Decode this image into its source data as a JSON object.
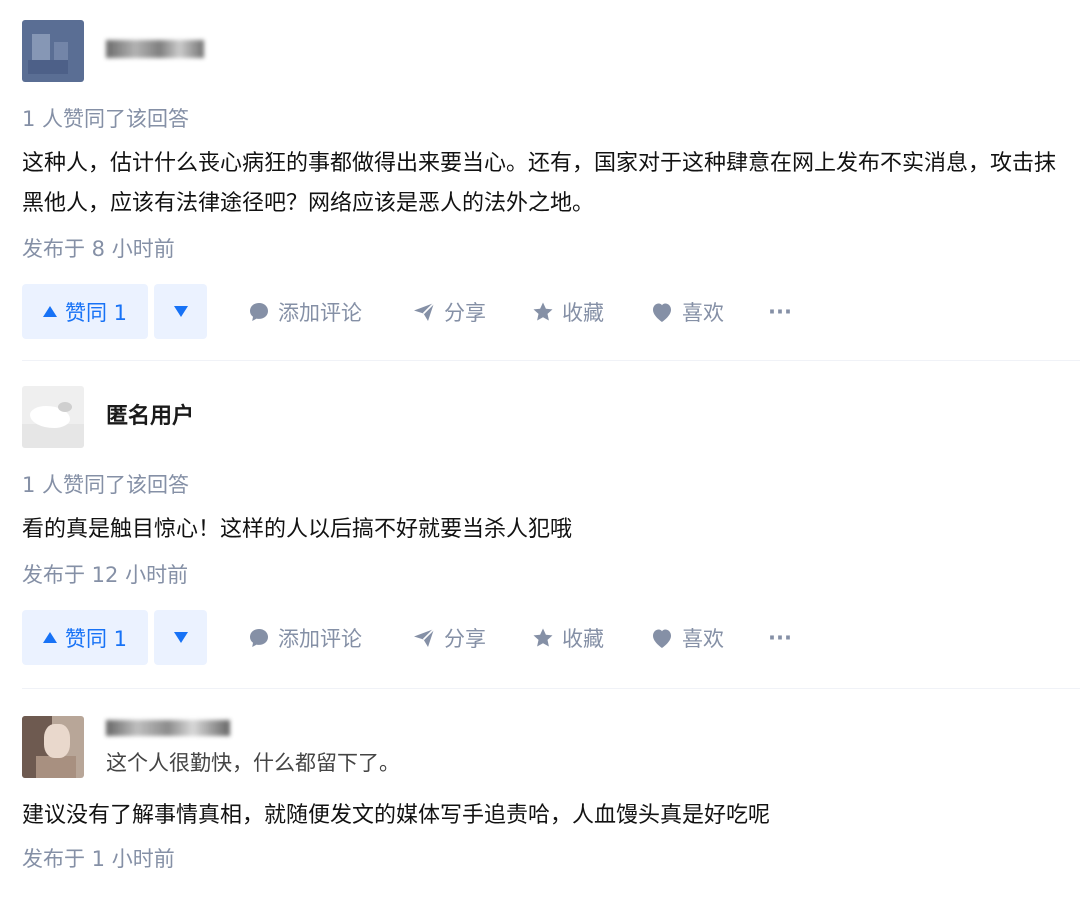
{
  "answers": [
    {
      "author_name": "",
      "bio": "",
      "upvote_note": "1 人赞同了该回答",
      "content": "这种人，估计什么丧心病狂的事都做得出来要当心。还有，国家对于这种肆意在网上发布不实消息，攻击抹黑他人，应该有法律途径吧？网络应该是恶人的法外之地。",
      "published": "发布于 8 小时前",
      "vote_label": "赞同 1"
    },
    {
      "author_name": "匿名用户",
      "bio": "",
      "upvote_note": "1 人赞同了该回答",
      "content": "看的真是触目惊心！这样的人以后搞不好就要当杀人犯哦",
      "published": "发布于 12 小时前",
      "vote_label": "赞同 1"
    },
    {
      "author_name": "",
      "bio": "这个人很勤快，什么都留下了。",
      "upvote_note": "",
      "content": "建议没有了解事情真相，就随便发文的媒体写手追责哈，人血馒头真是好吃呢",
      "published": "发布于 1 小时前",
      "vote_label": ""
    }
  ],
  "actions": {
    "comment": "添加评论",
    "share": "分享",
    "favorite": "收藏",
    "like": "喜欢",
    "more": "···"
  },
  "icons": {
    "upvote": "triangle-up-icon",
    "downvote": "triangle-down-icon",
    "comment": "speech-bubble-icon",
    "share": "paper-plane-icon",
    "favorite": "star-icon",
    "like": "heart-icon",
    "more": "ellipsis-icon"
  },
  "colors": {
    "accent": "#1772f6",
    "vote_bg": "#ebf2ff",
    "muted": "#8590a6"
  }
}
